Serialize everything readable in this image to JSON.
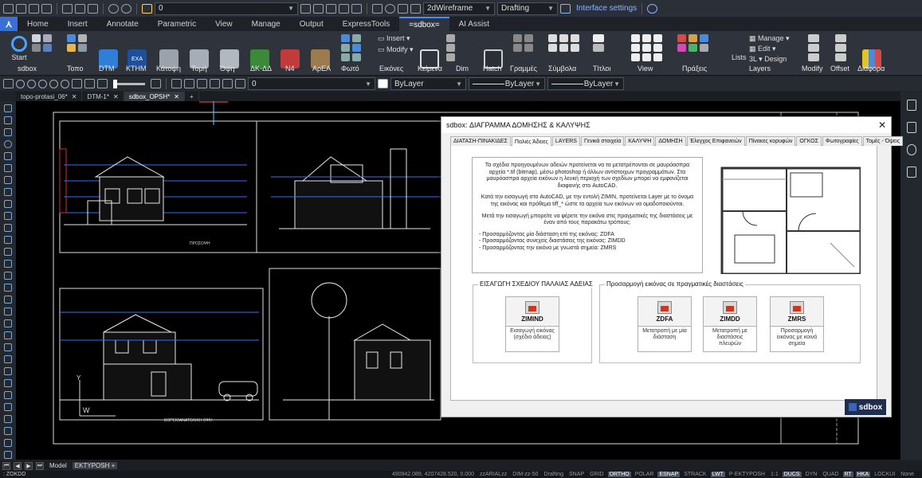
{
  "qat": {
    "layer_value": "0",
    "visual_style": "2dWireframe",
    "workspace": "Drafting",
    "interface_settings": "Interface settings",
    "help_icon": "help-icon"
  },
  "ribbon_tabs": [
    "Home",
    "Insert",
    "Annotate",
    "Parametric",
    "View",
    "Manage",
    "Output",
    "ExpressTools",
    "=sdbox=",
    "AI Assist"
  ],
  "active_ribbon_tab": "=sdbox=",
  "ribbon": {
    "start_label": "Start",
    "zimin_label": "Insert",
    "modify_label": "Modify",
    "manage_label": "Manage",
    "edit_label": "Edit",
    "design_label": "Design",
    "lists_label": "Lists",
    "panels": [
      "sdbox",
      "Τοπο",
      "DTM",
      "ΚΤΗΜ",
      "Κάτοψη",
      "Τομή",
      "Όψη",
      "ΔΚ-ΔΔ",
      "Ν4",
      "ΑρΕΑ",
      "Φωτό",
      "Εικόνες",
      "Κείμενα",
      "Dim",
      "Hatch",
      "Γραμμές",
      "Σύμβολα",
      "Τίτλοι",
      "View",
      "Πράξεις",
      "Layers",
      "Modify",
      "Offset",
      "Διάφορα"
    ]
  },
  "properties_bar": {
    "layer_value": "0",
    "color": "ByLayer",
    "linetype": "ByLayer",
    "lineweight": "ByLayer"
  },
  "doc_tabs": [
    {
      "label": "topo-protasi_06*",
      "active": false
    },
    {
      "label": "DTM-1*",
      "active": false
    },
    {
      "label": "sdbox_OPSH*",
      "active": true
    }
  ],
  "drawing": {
    "front_caption": "ΠΡΟΣΟΨΗ",
    "ne_caption": "ΒΟΡΕΙΟΑΝΑΤΟΛΙΚΗ ΟΨΗ",
    "ucs_w": "W",
    "ucs_y": "Y"
  },
  "dialog": {
    "title": "sdbox: ΔΙΑΓΡΑΜΜΑ ΔΟΜΗΣΗΣ & ΚΑΛΥΨΗΣ",
    "close": "✕",
    "tabs": [
      "ΔΙΑΤΑΣΗ-ΠΙΝΑΚΙΔΕΣ",
      "Παλιές Άδειες",
      "LAYERS",
      "Γενικά στοιχεία",
      "ΚΑΛΥΨΗ",
      "ΔΟΜΗΣΗ",
      "Έλεγχος Επιφανειών",
      "Πίνακες κορυφών",
      "ΟΓΚΟΣ",
      "Φωτογραφίες",
      "Τομές - Όψεις"
    ],
    "active_tab": "Παλιές Άδειες",
    "para1": "Τα σχέδια προηγουμένων αδειών προτείνεται να τα μετατρέπονται σε μαυρόασπρα αρχεία *.tif (bitmap), μέσω photoshop ή άλλων αντίστοιχων προγραμμάτων. Στα μαυρόασπρα αρχεία εικόνων η λευκή περιοχή των σχεδίων μπορεί να εμφανίζεται διαφανής στο AutoCAD.",
    "para2": "Κατά την εισαγωγή στο AutoCAD, με την εντολή ZIMIN, προτείνεται Layer με το όνομα της εικόνας και πρόθεμα tiff_* ώστε τα αρχεία των εικόνων να ομαδοποιούνται.",
    "para3": "Μετά την εισαγωγή μπορείτε να φέρετε την εικόνα στις πραγματικές της διαστάσεις με έναν από τους παρακάτω τρόπους:",
    "cmd1": "- Προσαρμόζοντας μία διάσταση επί της εικόνας:      ZDFA",
    "cmd2": "- Προσαρμόζοντας συνεχείς διαστάσεις της εικόνας:   ZIMDD",
    "cmd3": "- Προσαρμόζοντας την εικόνα με γνωστά σημεία:       ZMRS",
    "group1_title": "ΕΙΣΑΓΩΓΗ ΣΧΕΔΙΟΥ ΠΑΛΑΙΑΣ ΑΔΕΙΑΣ",
    "group2_title": "Προσαρμογή εικόνας σε πραγματικές διαστάσεις",
    "tools": [
      {
        "label": "ZIMIND",
        "desc": "Εισαγωγή εικόνας (σχέδιο άδειας)"
      },
      {
        "label": "ZDFA",
        "desc": "Μετατροπή με μία διάσταση"
      },
      {
        "label": "ZIMDD",
        "desc": "Μετατροπή με διαστάσεις πλευρών"
      },
      {
        "label": "ZMRS",
        "desc": "Προσαρμογή εικόνας με κοινά σημεία"
      }
    ],
    "logo": "sdbox"
  },
  "layouts": {
    "model": "Model",
    "sheet": "EKTYPOSH +"
  },
  "status": {
    "command": ": ZOKDD",
    "items": [
      "490942.089, 4207428.520, 0.000",
      "zzARIALzz",
      "DIM-zz-50",
      "Drafting",
      "SNAP",
      "GRID",
      "ORTHO",
      "POLAR",
      "ESNAP",
      "STRACK",
      "LWT",
      "P-EKTYPOSH",
      "1:1",
      "DUCS",
      "DYN",
      "QUAD",
      "RT",
      "HKA",
      "LOCKUI",
      "None"
    ],
    "on": [
      "ORTHO",
      "ESNAP",
      "LWT",
      "DUCS",
      "RT",
      "HKA"
    ]
  },
  "colors": {
    "accent": "#3a6fd8",
    "canvas": "#000000",
    "dialog": "#f0f0f0"
  }
}
